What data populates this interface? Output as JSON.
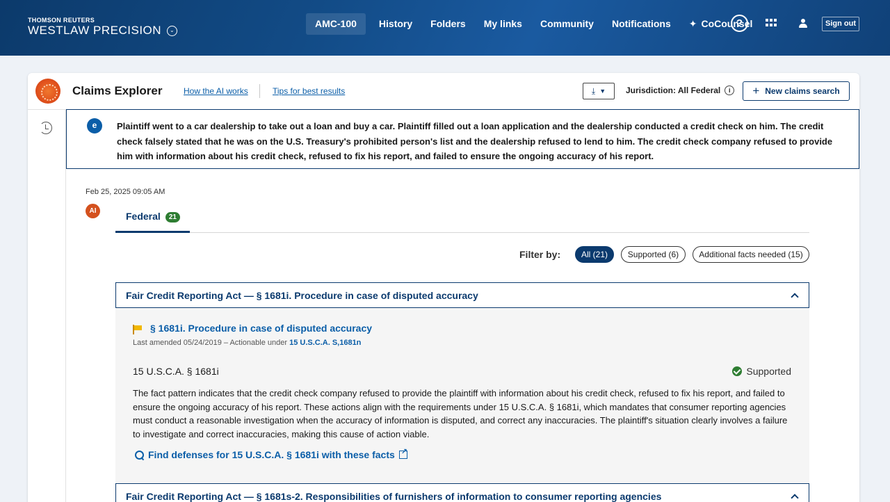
{
  "header": {
    "brand_top": "THOMSON REUTERS",
    "brand_name": "WESTLAW PRECISION",
    "nav": [
      "AMC-100",
      "History",
      "Folders",
      "My links",
      "Community",
      "Notifications",
      "CoCounsel"
    ],
    "help": "?",
    "signout": "Sign out"
  },
  "tool": {
    "title": "Claims Explorer",
    "how_link": "How the AI works",
    "tips_link": "Tips for best results",
    "jurisdiction": "Jurisdiction: All Federal",
    "new_search": "New claims search"
  },
  "query": {
    "badge": "e",
    "text": "Plaintiff went to a car dealership to take out a loan and buy a car. Plaintiff filled out a loan application and the dealership conducted a credit check on him. The credit check falsely stated that he was on the U.S. Treasury's prohibited person's list and the dealership refused to lend to him. The credit check company refused to provide him with information about his credit check, refused to fix his report, and failed to ensure the ongoing accuracy of his report."
  },
  "result": {
    "timestamp": "Feb 25, 2025 09:05 AM",
    "ai_badge": "AI",
    "tab_label": "Federal",
    "tab_count": "21",
    "filter_label": "Filter by:",
    "filters": [
      "All (21)",
      "Supported (6)",
      "Additional facts needed (15)"
    ]
  },
  "sections": [
    {
      "title": "Fair Credit Reporting Act — § 1681i. Procedure in case of disputed accuracy",
      "statute_title": "§ 1681i. Procedure in case of disputed accuracy",
      "amended": "Last amended 05/24/2019  –  Actionable under ",
      "actionable": "15 U.S.C.A. S,1681n",
      "citation": "15 U.S.C.A. § 1681i",
      "status": "Supported",
      "analysis": "The fact pattern indicates that the credit check company refused to provide the plaintiff with information about his credit check, refused to fix his report, and failed to ensure the ongoing accuracy of his report. These actions align with the requirements under 15 U.S.C.A. § 1681i, which mandates that consumer reporting agencies must conduct a reasonable investigation when the accuracy of information is disputed, and correct any inaccuracies. The plaintiff's situation clearly involves a failure to investigate and correct inaccuracies, making this cause of action viable.",
      "defenses": "Find defenses for 15 U.S.C.A. § 1681i with these facts"
    },
    {
      "title": "Fair Credit Reporting Act — § 1681s-2. Responsibilities of furnishers of information to consumer reporting agencies"
    }
  ]
}
